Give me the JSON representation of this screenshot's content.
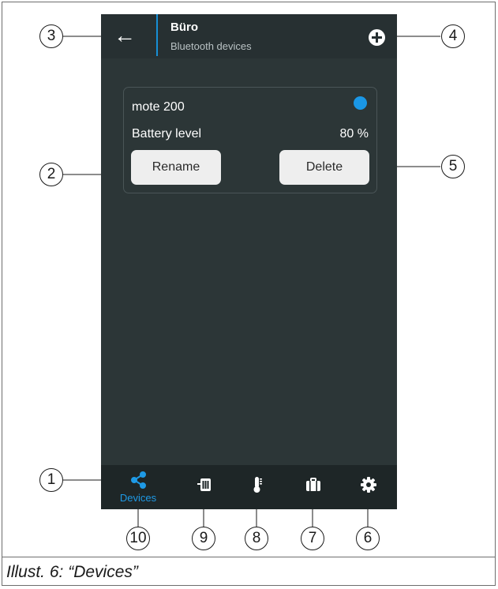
{
  "header": {
    "title": "Büro",
    "subtitle": "Bluetooth devices",
    "back_icon": "arrow-left-icon",
    "add_icon": "plus-circle-icon"
  },
  "device_card": {
    "name": "mote 200",
    "status_color": "#1a97e6",
    "battery_label": "Battery level",
    "battery_value": "80 %",
    "rename_label": "Rename",
    "delete_label": "Delete"
  },
  "bottom_nav": {
    "items": [
      {
        "icon": "share-nodes-icon",
        "label": "Devices",
        "active": true
      },
      {
        "icon": "battery-storage-icon"
      },
      {
        "icon": "thermometer-icon"
      },
      {
        "icon": "briefcase-icon"
      },
      {
        "icon": "gear-icon"
      }
    ],
    "active_color": "#1e9ae6"
  },
  "callouts": {
    "c1": "1",
    "c2": "2",
    "c3": "3",
    "c4": "4",
    "c5": "5",
    "c6": "6",
    "c7": "7",
    "c8": "8",
    "c9": "9",
    "c10": "10"
  },
  "caption": "Illust. 6: “Devices”"
}
